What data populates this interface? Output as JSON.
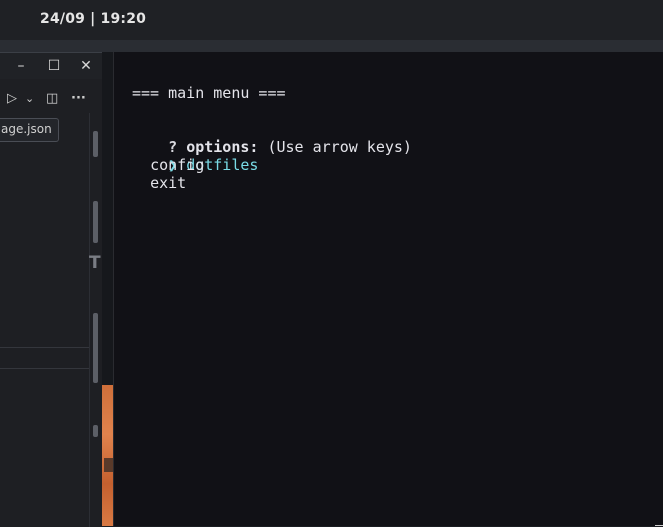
{
  "topbar": {
    "clock": "24/09 | 19:20"
  },
  "editor": {
    "window_buttons": {
      "minimize": "–",
      "maximize": "☐",
      "close": "✕"
    },
    "toolbar": {
      "run": "▷",
      "run_dropdown": "⌄",
      "split": "◫",
      "more": "···"
    },
    "tooltip": "age.json",
    "side_glyph": "T"
  },
  "terminal": {
    "header": "=== main menu ===",
    "prompt_mark": "?",
    "prompt_label": "options:",
    "prompt_hint": "(Use arrow keys)",
    "pointer": "❯",
    "items": [
      "dotfiles",
      "config",
      "exit"
    ]
  },
  "colors": {
    "terminal_bg": "#111116",
    "selected_item": "#79dbe6",
    "wallpaper": "#d97a44"
  }
}
